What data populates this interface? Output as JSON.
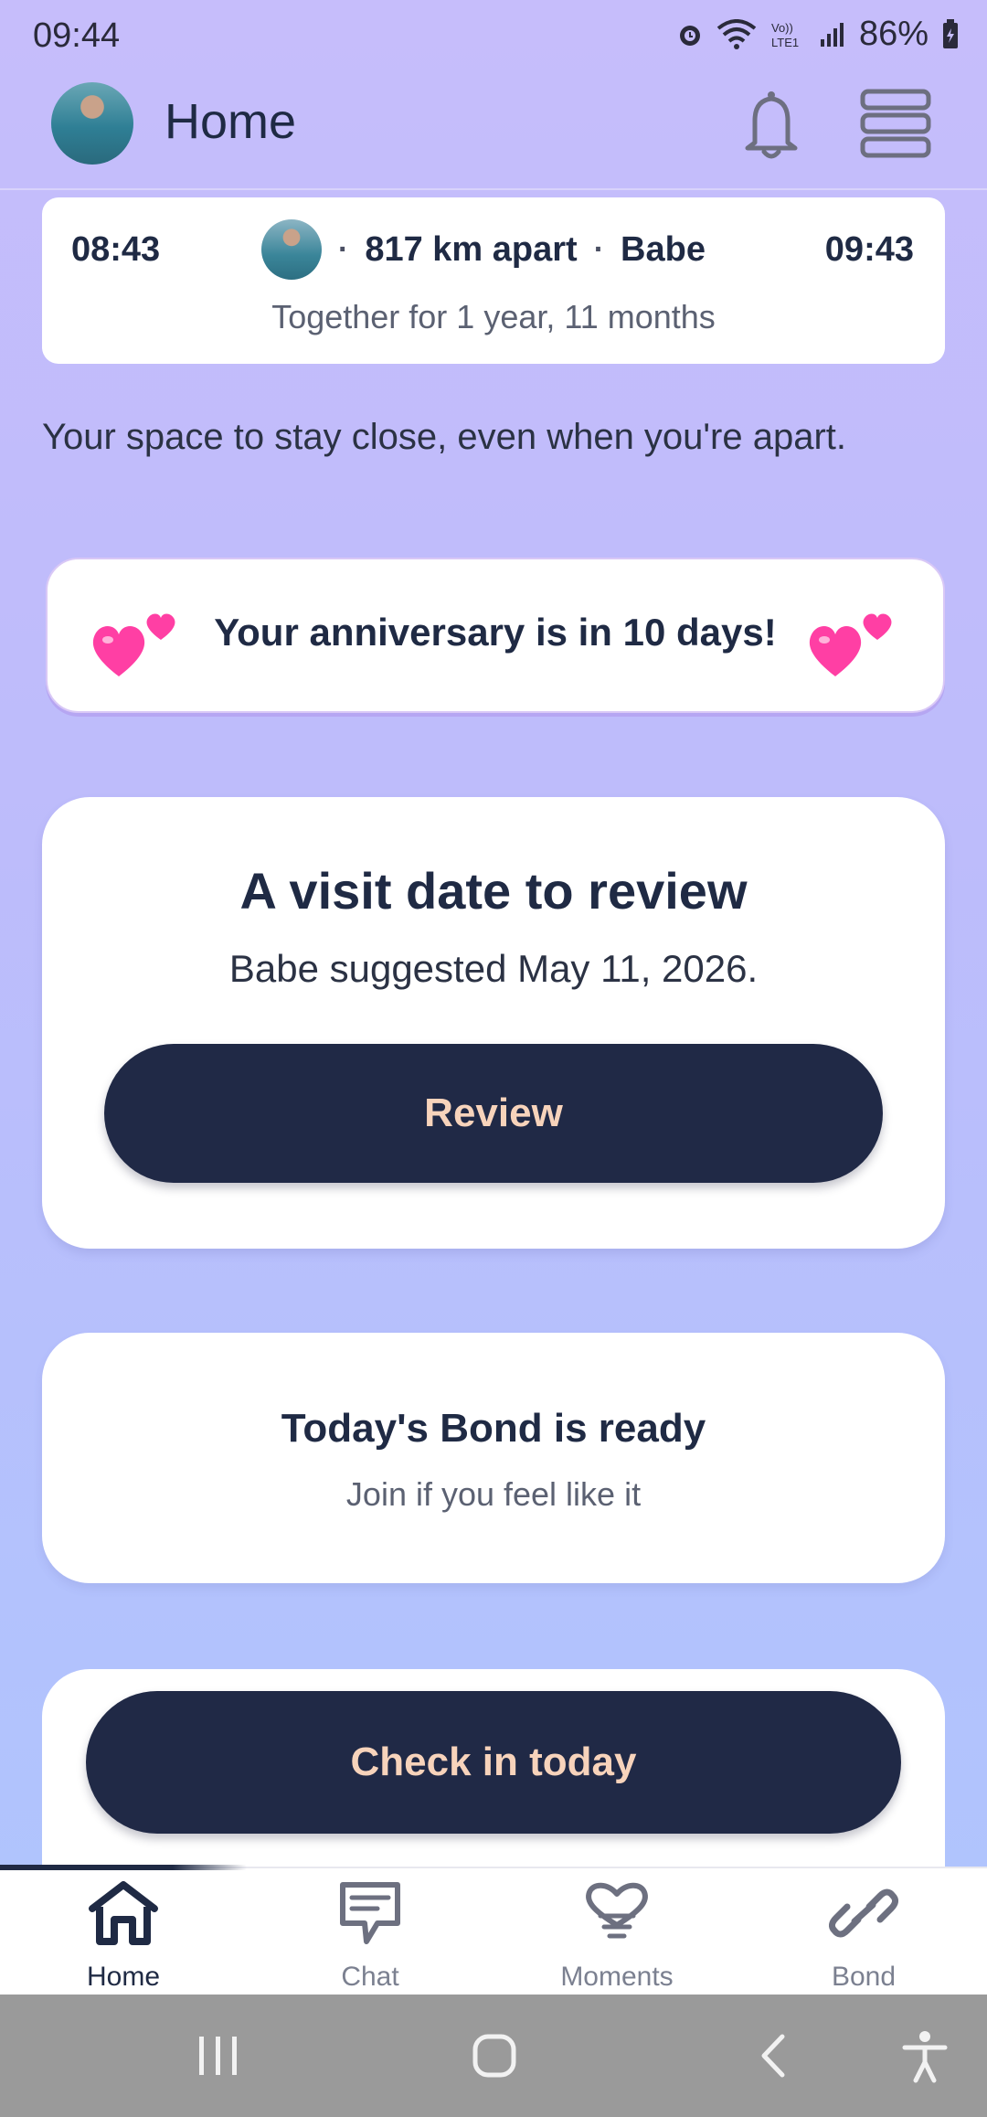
{
  "status": {
    "time": "09:44",
    "battery": "86%"
  },
  "appbar": {
    "title": "Home"
  },
  "info_card": {
    "local_time": "08:43",
    "partner_time": "09:43",
    "distance": "817 km apart",
    "partner_name": "Babe",
    "separator": "·",
    "together": "Together for 1 year, 11 months"
  },
  "tagline": "Your space to stay close, even when you're apart.",
  "anniversary": {
    "text": "Your anniversary is in 10 days!"
  },
  "visit": {
    "title": "A visit date to review",
    "subtitle": "Babe suggested May 11, 2026.",
    "button": "Review"
  },
  "bond": {
    "title": "Today's Bond is ready",
    "subtitle": "Join if you feel like it"
  },
  "checkin": {
    "button": "Check in today"
  },
  "nav": {
    "items": [
      {
        "label": "Home",
        "icon": "home-icon"
      },
      {
        "label": "Chat",
        "icon": "chat-icon"
      },
      {
        "label": "Moments",
        "icon": "moments-icon"
      },
      {
        "label": "Bond",
        "icon": "link-icon"
      }
    ]
  },
  "colors": {
    "accent_dark": "#202946",
    "button_text": "#f7d3bb",
    "heart": "#ff3fa4"
  }
}
